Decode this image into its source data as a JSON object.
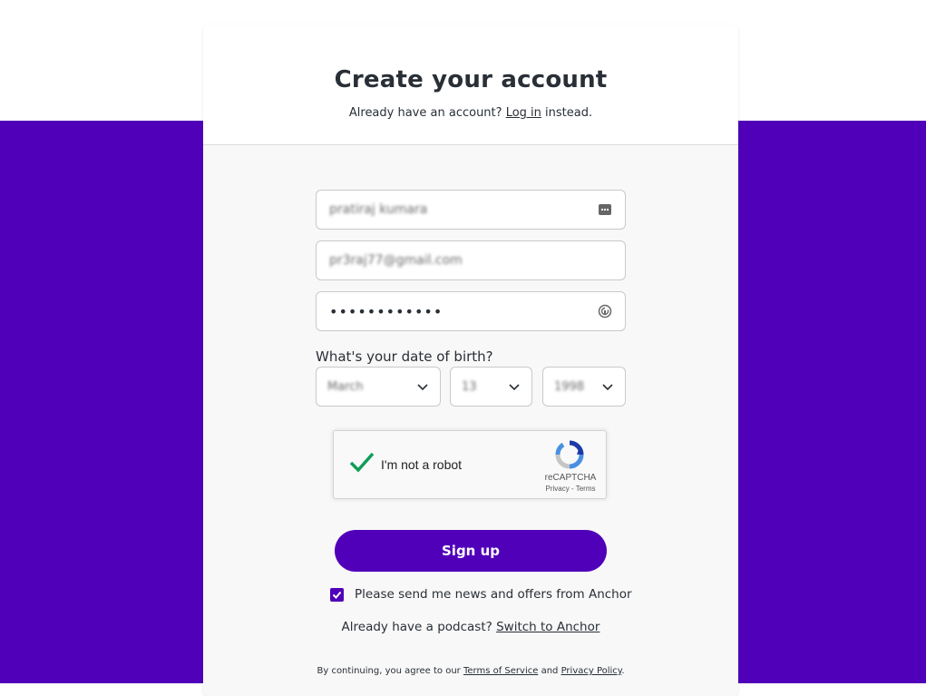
{
  "colors": {
    "brand": "#5000b9",
    "check_green": "#0f9d58"
  },
  "header": {
    "title": "Create your account",
    "login_prompt": "Already have an account?",
    "login_link": "Log in",
    "login_suffix": "instead."
  },
  "form": {
    "name_value": "pratiraj kumara",
    "email_value": "pr3raj77@gmail.com",
    "password_value": "••••••••••••",
    "dob_label": "What's your date of birth?",
    "dob_month": "March",
    "dob_day": "13",
    "dob_year": "1998"
  },
  "recaptcha": {
    "label": "I'm not a robot",
    "brand": "reCAPTCHA",
    "privacy": "Privacy",
    "separator": " - ",
    "terms": "Terms"
  },
  "signup_button": "Sign up",
  "newsletter": {
    "checked": true,
    "label": "Please send me news and offers from Anchor"
  },
  "podcast": {
    "prompt": "Already have a podcast?",
    "link": "Switch to Anchor"
  },
  "legal": {
    "prefix": "By continuing, you agree to our",
    "tos": "Terms of Service",
    "and": "and",
    "privacy": "Privacy Policy",
    "suffix": "."
  },
  "icons": {
    "name_field": "contact-card-icon",
    "password_field": "password-manager-icon",
    "dropdown": "chevron-down-icon",
    "recaptcha_check": "check-icon",
    "recaptcha_logo": "recaptcha-logo-icon"
  }
}
